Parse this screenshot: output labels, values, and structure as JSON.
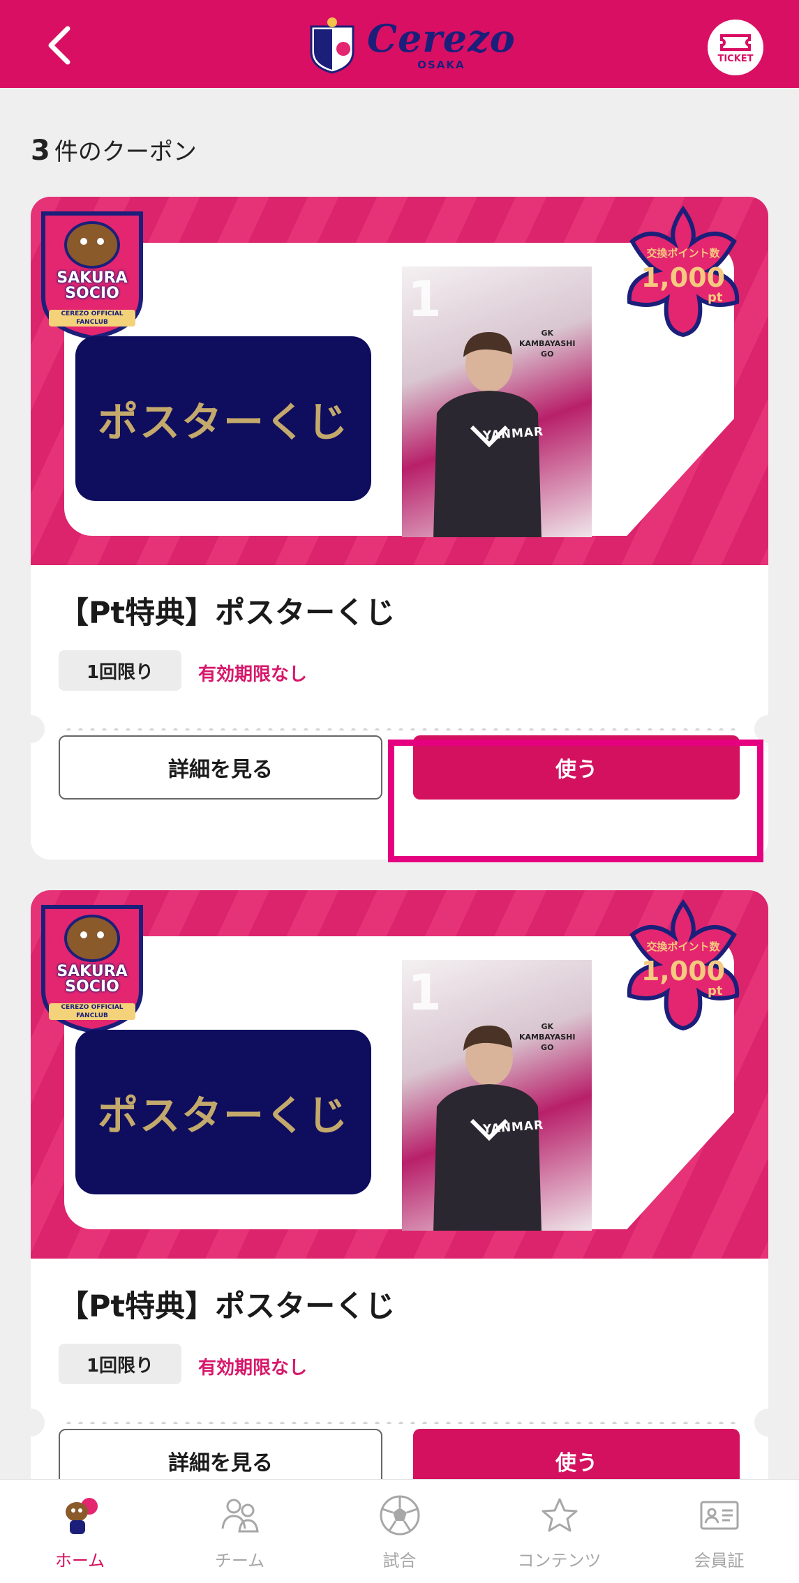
{
  "header": {
    "brand_name": "Cerezo",
    "brand_sub": "OSAKA",
    "ticket_label": "TICKET"
  },
  "summary": {
    "count": "3",
    "count_suffix": "件のクーポン"
  },
  "coupons": [
    {
      "banner_text": "ポスターくじ",
      "fanclub_name": "SAKURA SOCIO",
      "fanclub_sub": "CEREZO OFFICIAL FANCLUB",
      "points_label": "交換ポイント数",
      "points_value": "1,000",
      "points_unit": "pt",
      "player_position": "GK",
      "player_name_1": "KAMBAYASHI",
      "player_name_2": "GO",
      "jersey_number": "1",
      "shirt_sponsor": "YANMAR",
      "title": "【Pt特典】ポスターくじ",
      "limit": "1回限り",
      "expiry": "有効期限なし",
      "detail_label": "詳細を見る",
      "use_label": "使う"
    },
    {
      "banner_text": "ポスターくじ",
      "fanclub_name": "SAKURA SOCIO",
      "fanclub_sub": "CEREZO OFFICIAL FANCLUB",
      "points_label": "交換ポイント数",
      "points_value": "1,000",
      "points_unit": "pt",
      "player_position": "GK",
      "player_name_1": "KAMBAYASHI",
      "player_name_2": "GO",
      "jersey_number": "1",
      "shirt_sponsor": "YANMAR",
      "title": "【Pt特典】ポスターくじ",
      "limit": "1回限り",
      "expiry": "有効期限なし",
      "detail_label": "詳細を見る",
      "use_label": "使う"
    }
  ],
  "nav": [
    {
      "label": "ホーム",
      "icon": "mascot-icon",
      "active": true
    },
    {
      "label": "チーム",
      "icon": "team-icon",
      "active": false
    },
    {
      "label": "試合",
      "icon": "soccer-ball-icon",
      "active": false
    },
    {
      "label": "コンテンツ",
      "icon": "star-icon",
      "active": false
    },
    {
      "label": "会員証",
      "icon": "member-card-icon",
      "active": false
    }
  ],
  "colors": {
    "brand_pink": "#d90f63",
    "navy": "#0f0d5e",
    "gold": "#c3a96b",
    "highlight": "#e4007f"
  }
}
